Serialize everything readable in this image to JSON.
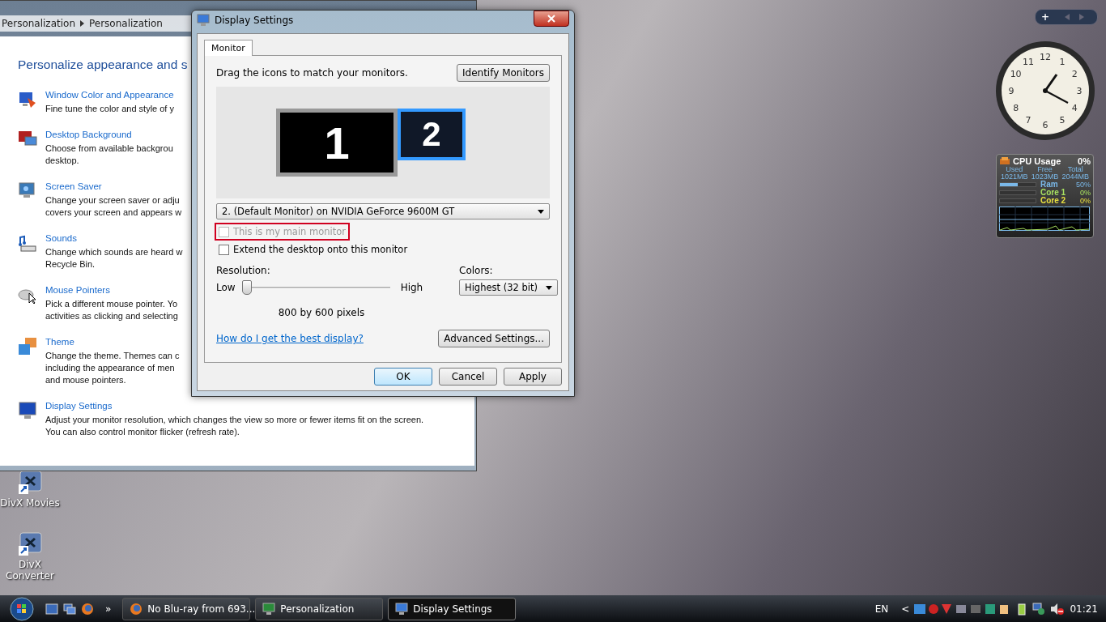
{
  "personalization_window": {
    "breadcrumb": [
      "Personalization",
      "Personalization"
    ],
    "heading": "Personalize appearance and s",
    "items": [
      {
        "kind": "window-color",
        "title": "Window Color and Appearance",
        "description": [
          "Fine tune the color and style of y"
        ]
      },
      {
        "kind": "background",
        "title": "Desktop Background",
        "description": [
          "Choose from available backgrou",
          "desktop."
        ]
      },
      {
        "kind": "screensaver",
        "title": "Screen Saver",
        "description": [
          "Change your screen saver or adju",
          "covers your screen and appears w"
        ]
      },
      {
        "kind": "sounds",
        "title": "Sounds",
        "description": [
          "Change which sounds are heard w",
          "Recycle Bin."
        ]
      },
      {
        "kind": "mouse",
        "title": "Mouse Pointers",
        "description": [
          "Pick a different mouse pointer. Yo",
          "activities as clicking and selecting"
        ]
      },
      {
        "kind": "theme",
        "title": "Theme",
        "description": [
          "Change the theme. Themes can c",
          "including the appearance of men",
          "and mouse pointers."
        ]
      },
      {
        "kind": "display",
        "title": "Display Settings",
        "description": [
          "Adjust your monitor resolution, which changes the view so more or fewer items fit on the screen.",
          "You can also control monitor flicker (refresh rate)."
        ]
      }
    ]
  },
  "dialog": {
    "title": "Display Settings",
    "tabs": [
      {
        "label": "Monitor",
        "selected": true
      }
    ],
    "instruction": "Drag the icons to match your monitors.",
    "identify_button": "Identify Monitors",
    "monitors": [
      {
        "label": "1",
        "selected": false
      },
      {
        "label": "2",
        "selected": true
      }
    ],
    "monitor_select": "2. (Default Monitor) on NVIDIA GeForce 9600M GT",
    "checkboxes": [
      {
        "label": "This is my main monitor",
        "checked": false,
        "disabled": true,
        "highlighted": true
      },
      {
        "label": "Extend the desktop onto this monitor",
        "checked": false,
        "disabled": false,
        "highlighted": false
      }
    ],
    "resolution": {
      "label": "Resolution:",
      "low": "Low",
      "high": "High",
      "level": 0,
      "reading": "800 by 600 pixels"
    },
    "colors": {
      "label": "Colors:",
      "value": "Highest (32 bit)"
    },
    "help_link": "How do I get the best display?",
    "advanced_button": "Advanced Settings...",
    "buttons": [
      {
        "label": "OK",
        "default": true
      },
      {
        "label": "Cancel",
        "default": false
      },
      {
        "label": "Apply",
        "default": false
      }
    ]
  },
  "sidebar_controls": {
    "add": "+"
  },
  "clock": {
    "numerals": [
      "12",
      "1",
      "2",
      "3",
      "4",
      "5",
      "6",
      "7",
      "8",
      "9",
      "10",
      "11"
    ]
  },
  "cpu_gadget": {
    "title": "CPU Usage",
    "total": "0%",
    "headers": [
      "Used",
      "Free",
      "Total"
    ],
    "values": [
      "1021MB",
      "1023MB",
      "2044MB"
    ],
    "meters": [
      {
        "name": "Ram",
        "reading": "50%",
        "level": 0.5,
        "color": "#7ab8e8"
      },
      {
        "name": "Core 1",
        "reading": "0%",
        "level": 0,
        "color": "#a8e060"
      },
      {
        "name": "Core 2",
        "reading": "0%",
        "level": 0,
        "color": "#e8e040"
      }
    ]
  },
  "desktop_icons": [
    {
      "label": "DivX Movies"
    },
    {
      "label": "DivX Converter"
    }
  ],
  "taskbar": {
    "overflow": "»",
    "tasks": [
      {
        "label": "No Blu-ray from 693...",
        "kind": "browser",
        "selected": false
      },
      {
        "label": "Personalization",
        "kind": "personalization",
        "selected": false
      },
      {
        "label": "Display Settings",
        "kind": "display",
        "selected": true
      }
    ],
    "language": "EN",
    "tray_expand": "<",
    "time": "01:21"
  }
}
